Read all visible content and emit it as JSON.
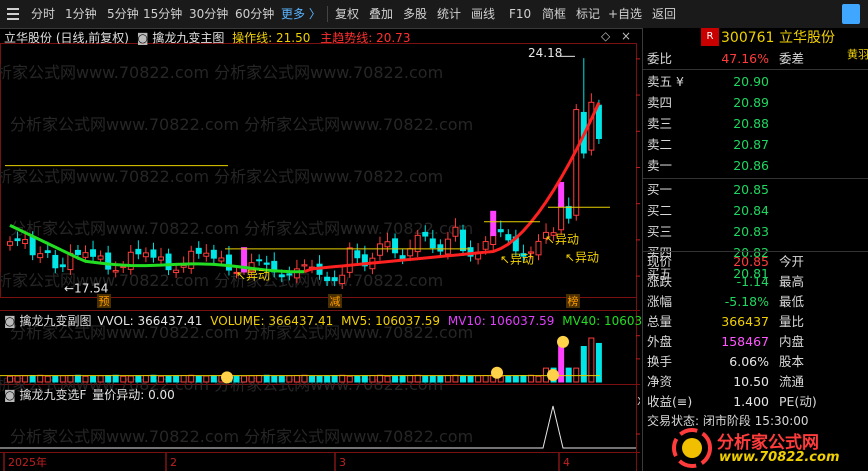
{
  "toolbar": {
    "items": [
      "分时",
      "1分钟",
      "5分钟",
      "15分钟",
      "30分钟",
      "60分钟",
      "更多 〉",
      "复权",
      "叠加",
      "多股",
      "统计",
      "画线",
      "F10",
      "简框",
      "标记",
      "+自选",
      "返回"
    ]
  },
  "main_chart": {
    "title": "立华股份 (日线,前复权)",
    "indicator_name": "擒龙九变主图",
    "op_line_label": "操作线:",
    "op_line_value": "21.50",
    "trend_line_label": "主趋势线:",
    "trend_line_value": "20.73",
    "price_ticks": [
      "24.00",
      "23.00",
      "22.00",
      "21.00",
      "20.00",
      "19.00",
      "18.00"
    ],
    "high_label": "24.18",
    "low_label": "17.54",
    "signal_label": "异动",
    "event_labels": [
      "预",
      "减",
      "榜"
    ]
  },
  "vol_chart": {
    "indicator_name": "擒龙九变副图",
    "vvol": "VVOL: 366437.41",
    "volume": "VOLUME: 366437.41",
    "mv5": "MV5: 106037.59",
    "mv10": "MV10: 106037.59",
    "mv40": "MV40: 106037.59",
    "ticks": [
      "60000",
      "30000"
    ],
    "unit": "X10"
  },
  "sel_chart": {
    "indicator_name": "擒龙九变选F",
    "value_text": "量价异动: 0.00",
    "ticks": [
      "1.00"
    ]
  },
  "x_axis": {
    "labels": [
      "2025年",
      "2",
      "3",
      "4"
    ],
    "day_tab": "日"
  },
  "colors": {
    "up": "#ff3b3b",
    "down": "#00e5e5",
    "trend_up": "#ff2020",
    "trend_down": "#22dd22"
  },
  "quote": {
    "logo_badge": "R",
    "code": "300761",
    "name": "立华股份",
    "link": "黄羽鸡",
    "weibi_label": "委比",
    "weibi_value": "47.16%",
    "weicha_label": "委差",
    "asks": [
      {
        "label": "卖五 ¥",
        "price": "20.90"
      },
      {
        "label": "卖四",
        "price": "20.89"
      },
      {
        "label": "卖三",
        "price": "20.88"
      },
      {
        "label": "卖二",
        "price": "20.87"
      },
      {
        "label": "卖一",
        "price": "20.86"
      }
    ],
    "bids": [
      {
        "label": "买一",
        "price": "20.85"
      },
      {
        "label": "买二",
        "price": "20.84"
      },
      {
        "label": "买三",
        "price": "20.83"
      },
      {
        "label": "买四",
        "price": "20.82"
      },
      {
        "label": "买五",
        "price": "20.81"
      }
    ],
    "stats": [
      {
        "l1": "现价",
        "v1": "20.85",
        "c1": "red",
        "l2": "今开"
      },
      {
        "l1": "涨跌",
        "v1": "-1.14",
        "c1": "green",
        "l2": "最高"
      },
      {
        "l1": "涨幅",
        "v1": "-5.18%",
        "c1": "green",
        "l2": "最低"
      },
      {
        "l1": "总量",
        "v1": "366437",
        "c1": "yellow",
        "l2": "量比"
      },
      {
        "l1": "外盘",
        "v1": "158467",
        "c1": "pink",
        "l2": "内盘"
      },
      {
        "l1": "换手",
        "v1": "6.06%",
        "c1": "white",
        "l2": "股本"
      },
      {
        "l1": "净资",
        "v1": "10.50",
        "c1": "white",
        "l2": "流通"
      },
      {
        "l1": "收益(≡)",
        "v1": "1.400",
        "c1": "white",
        "l2": "PE(动)"
      }
    ],
    "trade_status": "交易状态: 闭市阶段 15:30:00"
  },
  "watermark": {
    "text": "分析家公式网www.70822.com",
    "brand": "分析家公式网",
    "url": "www.70822.com"
  }
}
